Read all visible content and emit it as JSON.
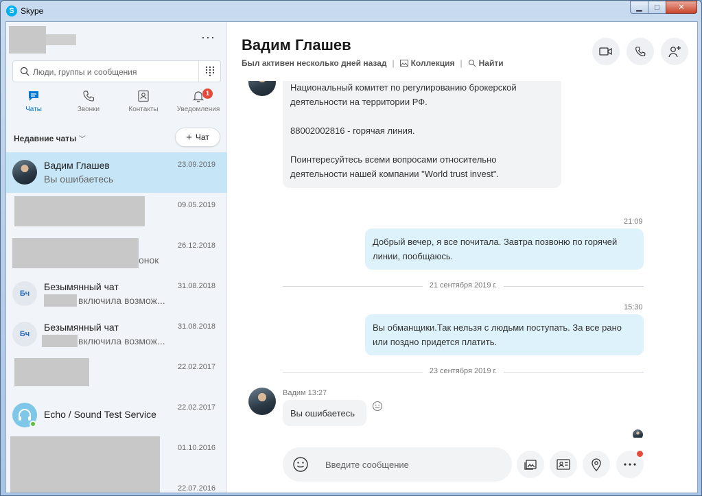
{
  "window": {
    "title": "Skype",
    "logo_letter": "S",
    "min_label": "▁",
    "max_label": "□",
    "close_label": "✕"
  },
  "sidebar": {
    "more_label": "···",
    "search": {
      "placeholder": "Люди, группы и сообщения"
    },
    "tabs": [
      {
        "label": "Чаты",
        "icon": "chat-icon",
        "active": true
      },
      {
        "label": "Звонки",
        "icon": "phone-icon"
      },
      {
        "label": "Контакты",
        "icon": "contacts-icon"
      },
      {
        "label": "Уведомления",
        "icon": "bell-icon",
        "badge": "1"
      }
    ],
    "recent_label": "Недавние чаты",
    "recent_chevron": "﹀",
    "new_chat_plus": "+",
    "new_chat_label": "Чат",
    "chats": [
      {
        "name": "Вадим Глашев",
        "preview": "Вы ошибаетесь",
        "date": "23.09.2019",
        "active": true
      },
      {
        "name": "",
        "preview": "",
        "date": "09.05.2019"
      },
      {
        "name": "",
        "preview": "онок",
        "date": "26.12.2018"
      },
      {
        "name": "Безымянный чат",
        "preview": "включила возмож...",
        "date": "31.08.2018",
        "initials": "Бч"
      },
      {
        "name": "Безымянный чат",
        "preview": "включила возмож...",
        "date": "31.08.2018",
        "initials": "Бч"
      },
      {
        "name": "",
        "preview": "",
        "date": "22.02.2017"
      },
      {
        "name": "Echo / Sound Test Service",
        "preview": "",
        "date": "22.02.2017"
      },
      {
        "name": "",
        "preview": "",
        "date": "01.10.2016"
      },
      {
        "name": "",
        "preview": "",
        "date": "22.07.2016"
      }
    ]
  },
  "header": {
    "contact_name": "Вадим Глашев",
    "status": "Был активен несколько дней назад",
    "separator": "|",
    "gallery_label": "Коллекция",
    "find_label": "Найти",
    "accent": "#0078d4"
  },
  "messages": {
    "first_bubble": [
      "Национальный комитет по регулированию брокерской",
      "деятельности на территории РФ.",
      "",
      "88002002816 - горячая линия.",
      "",
      "Поинтересуйтесь всеми вопросами относительно",
      "деятельности нашей компании \"World trust invest\"."
    ],
    "out1_time": "21:09",
    "out1_lines": [
      "Добрый вечер, я все почитала. Завтра позвоню по горячей",
      "линии, пообщаюсь."
    ],
    "day1": "21 сентября 2019 г.",
    "out2_time": "15:30",
    "out2_lines": [
      "Вы обманщики.Так нельзя с людьми поступать. За все рано",
      "или поздно придется платить."
    ],
    "day2": "23 сентября 2019 г.",
    "in_sender": "Вадим 13:27",
    "in_text": "Вы ошибаетесь"
  },
  "composer": {
    "placeholder": "Введите сообщение"
  },
  "colors": {
    "outgoing_bubble": "#ddf2fb",
    "incoming_bubble": "#f2f3f5",
    "active_chat": "#c6e6f7",
    "badge": "#e64a3a"
  }
}
